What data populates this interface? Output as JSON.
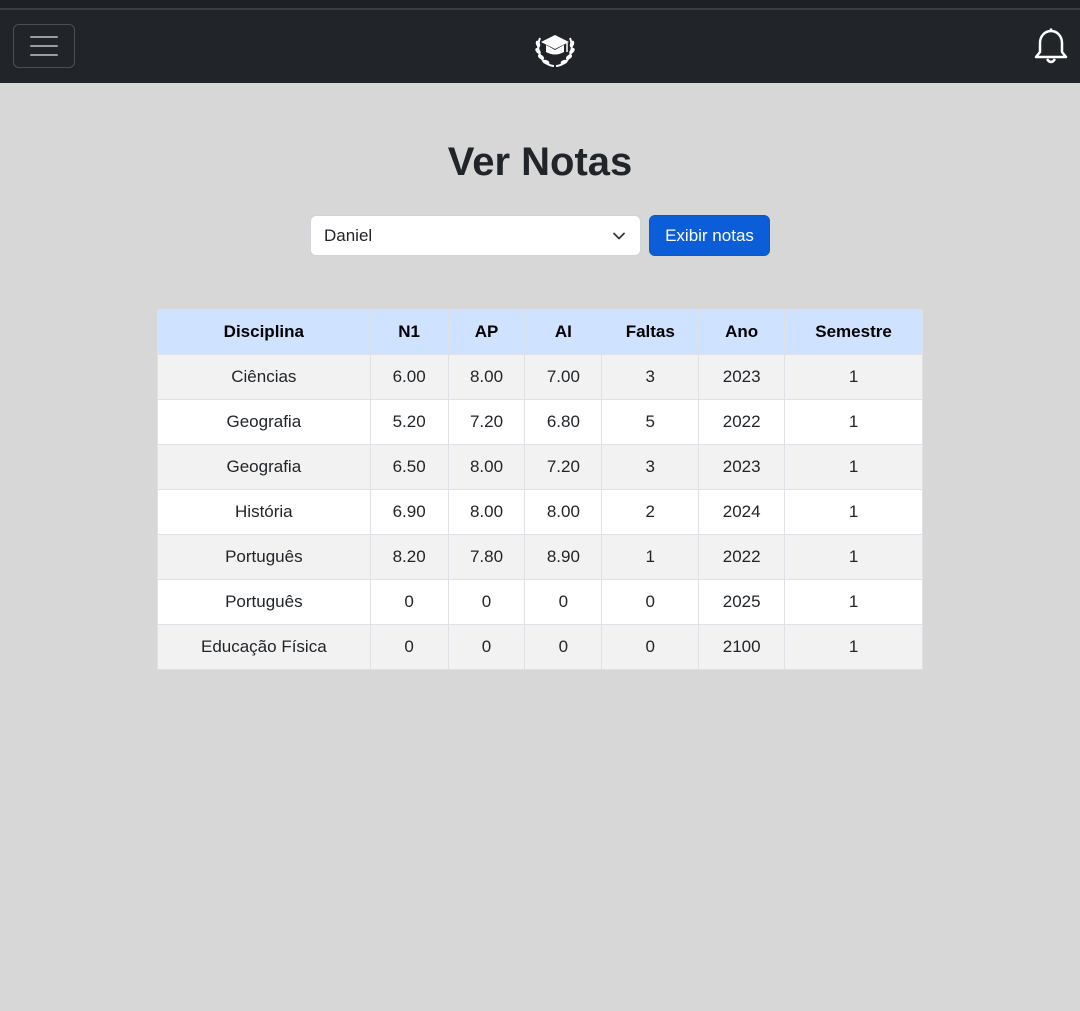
{
  "navbar": {
    "menu_icon": "hamburger-icon",
    "logo_icon": "graduation-cap-laurel-icon",
    "notification_icon": "bell-icon"
  },
  "page": {
    "title": "Ver Notas"
  },
  "filter": {
    "selected_student": "Daniel",
    "show_button_label": "Exibir notas"
  },
  "table": {
    "headers": [
      "Disciplina",
      "N1",
      "AP",
      "AI",
      "Faltas",
      "Ano",
      "Semestre"
    ],
    "rows": [
      [
        "Ciências",
        "6.00",
        "8.00",
        "7.00",
        "3",
        "2023",
        "1"
      ],
      [
        "Geografia",
        "5.20",
        "7.20",
        "6.80",
        "5",
        "2022",
        "1"
      ],
      [
        "Geografia",
        "6.50",
        "8.00",
        "7.20",
        "3",
        "2023",
        "1"
      ],
      [
        "História",
        "6.90",
        "8.00",
        "8.00",
        "2",
        "2024",
        "1"
      ],
      [
        "Português",
        "8.20",
        "7.80",
        "8.90",
        "1",
        "2022",
        "1"
      ],
      [
        "Português",
        "0",
        "0",
        "0",
        "0",
        "2025",
        "1"
      ],
      [
        "Educação Física",
        "0",
        "0",
        "0",
        "0",
        "2100",
        "1"
      ]
    ]
  },
  "colors": {
    "navbar_bg": "#212529",
    "page_bg": "#d7d7d7",
    "primary_button": "#0b5ed7",
    "table_header_bg": "#cfe2ff"
  }
}
